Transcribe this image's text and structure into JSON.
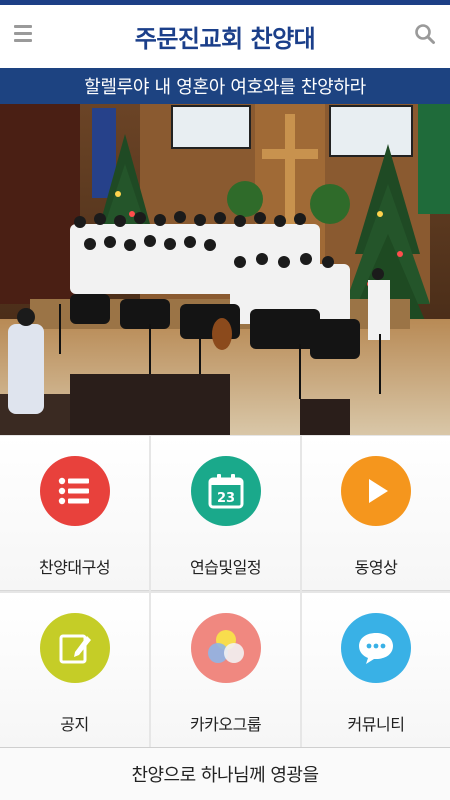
{
  "app": {
    "title": "주문진교회 찬양대",
    "banner_text": "할렐루야 내 영혼아 여호와를 찬양하라"
  },
  "header": {
    "menu_icon": "hamburger-icon",
    "search_icon": "search-icon"
  },
  "photo": {
    "description_icon": "choir-photo"
  },
  "menu_tiles": [
    {
      "label": "찬양대구성",
      "icon": "list-icon",
      "color": "#e8413c"
    },
    {
      "label": "연습및일정",
      "icon": "calendar-icon",
      "color": "#1aa98b",
      "calendar_number": "23"
    },
    {
      "label": "동영상",
      "icon": "play-icon",
      "color": "#f5961d"
    },
    {
      "label": "공지",
      "icon": "edit-note-icon",
      "color": "#c5cd27"
    },
    {
      "label": "카카오그룹",
      "icon": "group-circles-icon",
      "color": "#f08880"
    },
    {
      "label": "커뮤니티",
      "icon": "chat-bubble-icon",
      "color": "#39b1e6"
    }
  ],
  "footer": {
    "text": "찬양으로 하나님께 영광을"
  },
  "colors": {
    "brand_blue": "#1d4381",
    "title_blue": "#1b3f8a"
  }
}
